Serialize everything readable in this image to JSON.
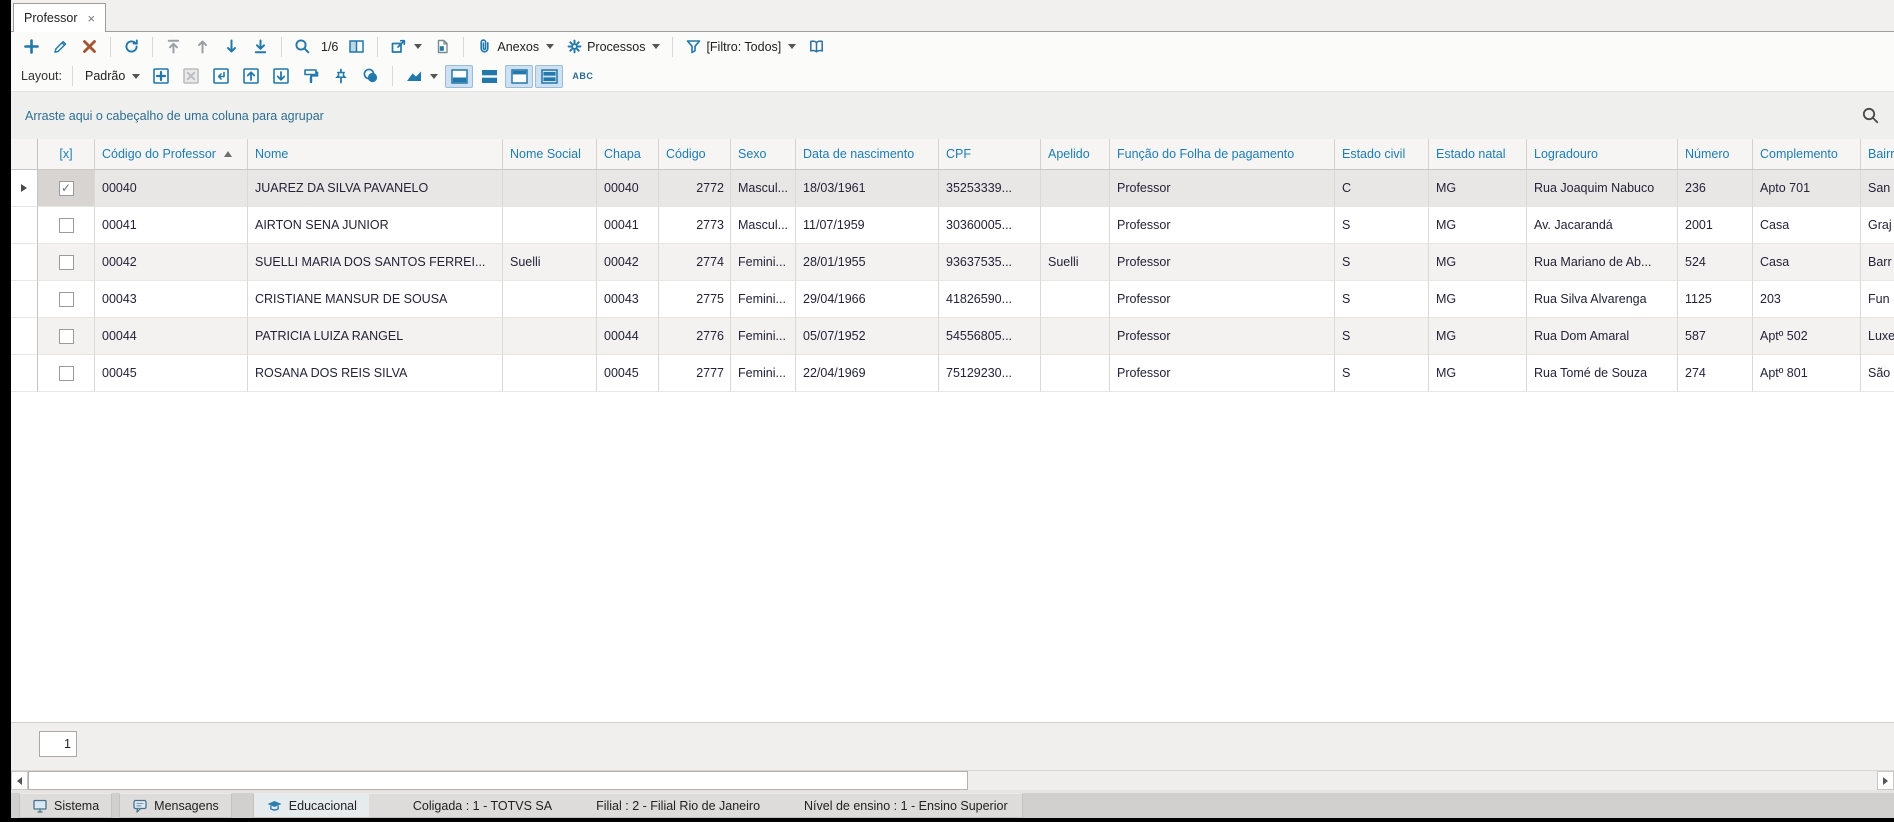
{
  "window": {
    "tab_title": "Professor",
    "close_label": "×"
  },
  "toolbar": {
    "record_position": "1/6",
    "anexos_label": "Anexos",
    "processos_label": "Processos",
    "filtro_label": "[Filtro: Todos]"
  },
  "layout_bar": {
    "label": "Layout:",
    "preset": "Padrão",
    "abc_label": "ABC"
  },
  "groupby_hint": "Arraste aqui o cabeçalho de uma coluna para agrupar",
  "grid": {
    "columns": [
      {
        "key": "check",
        "label": "[x]"
      },
      {
        "key": "codigo_professor",
        "label": "Código do Professor",
        "sort": "asc"
      },
      {
        "key": "nome",
        "label": "Nome"
      },
      {
        "key": "nome_social",
        "label": "Nome Social"
      },
      {
        "key": "chapa",
        "label": "Chapa"
      },
      {
        "key": "codigo",
        "label": "Código",
        "align": "right"
      },
      {
        "key": "sexo",
        "label": "Sexo"
      },
      {
        "key": "nascimento",
        "label": "Data de nascimento"
      },
      {
        "key": "cpf",
        "label": "CPF"
      },
      {
        "key": "apelido",
        "label": "Apelido"
      },
      {
        "key": "funcao",
        "label": "Função do Folha de pagamento"
      },
      {
        "key": "estado_civil",
        "label": "Estado civil"
      },
      {
        "key": "estado_natal",
        "label": "Estado natal"
      },
      {
        "key": "logradouro",
        "label": "Logradouro"
      },
      {
        "key": "numero",
        "label": "Número"
      },
      {
        "key": "complemento",
        "label": "Complemento"
      },
      {
        "key": "bairro",
        "label": "Bairro"
      }
    ],
    "rows": [
      {
        "selected": true,
        "checked": true,
        "cells": {
          "codigo_professor": "00040",
          "nome": "JUAREZ DA SILVA PAVANELO",
          "nome_social": "",
          "chapa": "00040",
          "codigo": "2772",
          "sexo": "Mascul...",
          "nascimento": "18/03/1961",
          "cpf": "35253339...",
          "apelido": "",
          "funcao": "Professor",
          "estado_civil": "C",
          "estado_natal": "MG",
          "logradouro": "Rua Joaquim Nabuco",
          "numero": "236",
          "complemento": "Apto 701",
          "bairro": "San"
        }
      },
      {
        "selected": false,
        "checked": false,
        "cells": {
          "codigo_professor": "00041",
          "nome": "AIRTON SENA JUNIOR",
          "nome_social": "",
          "chapa": "00041",
          "codigo": "2773",
          "sexo": "Mascul...",
          "nascimento": "11/07/1959",
          "cpf": "30360005...",
          "apelido": "",
          "funcao": "Professor",
          "estado_civil": "S",
          "estado_natal": "MG",
          "logradouro": "Av. Jacarandá",
          "numero": "2001",
          "complemento": "Casa",
          "bairro": "Graj"
        }
      },
      {
        "selected": false,
        "checked": false,
        "cells": {
          "codigo_professor": "00042",
          "nome": "SUELLI MARIA DOS SANTOS FERREI...",
          "nome_social": "Suelli",
          "chapa": "00042",
          "codigo": "2774",
          "sexo": "Femini...",
          "nascimento": "28/01/1955",
          "cpf": "93637535...",
          "apelido": "Suelli",
          "funcao": "Professor",
          "estado_civil": "S",
          "estado_natal": "MG",
          "logradouro": "Rua Mariano de Ab...",
          "numero": "524",
          "complemento": "Casa",
          "bairro": "Barr"
        }
      },
      {
        "selected": false,
        "checked": false,
        "cells": {
          "codigo_professor": "00043",
          "nome": "CRISTIANE MANSUR DE SOUSA",
          "nome_social": "",
          "chapa": "00043",
          "codigo": "2775",
          "sexo": "Femini...",
          "nascimento": "29/04/1966",
          "cpf": "41826590...",
          "apelido": "",
          "funcao": "Professor",
          "estado_civil": "S",
          "estado_natal": "MG",
          "logradouro": "Rua Silva Alvarenga",
          "numero": "1125",
          "complemento": "203",
          "bairro": "Fun"
        }
      },
      {
        "selected": false,
        "checked": false,
        "cells": {
          "codigo_professor": "00044",
          "nome": "PATRICIA LUIZA RANGEL",
          "nome_social": "",
          "chapa": "00044",
          "codigo": "2776",
          "sexo": "Femini...",
          "nascimento": "05/07/1952",
          "cpf": "54556805...",
          "apelido": "",
          "funcao": "Professor",
          "estado_civil": "S",
          "estado_natal": "MG",
          "logradouro": "Rua Dom Amaral",
          "numero": "587",
          "complemento": "Aptº 502",
          "bairro": "Luxe"
        }
      },
      {
        "selected": false,
        "checked": false,
        "cells": {
          "codigo_professor": "00045",
          "nome": "ROSANA DOS REIS SILVA",
          "nome_social": "",
          "chapa": "00045",
          "codigo": "2777",
          "sexo": "Femini...",
          "nascimento": "22/04/1969",
          "cpf": "75129230...",
          "apelido": "",
          "funcao": "Professor",
          "estado_civil": "S",
          "estado_natal": "MG",
          "logradouro": "Rua Tomé de Souza",
          "numero": "274",
          "complemento": "Aptº 801",
          "bairro": "São"
        }
      }
    ]
  },
  "pagination": {
    "page": "1"
  },
  "statusbar": {
    "sistema_label": "Sistema",
    "mensagens_label": "Mensagens",
    "educacional_label": "Educacional",
    "coligada": "Coligada : 1 - TOTVS SA",
    "filial": "Filial : 2 - Filial Rio de Janeiro",
    "nivel_ensino": "Nível de ensino : 1 - Ensino Superior"
  },
  "colors": {
    "accent": "#2278ab",
    "delete": "#a5542e",
    "header_text": "#1d7db3",
    "groupby_text": "#2e6e93"
  }
}
